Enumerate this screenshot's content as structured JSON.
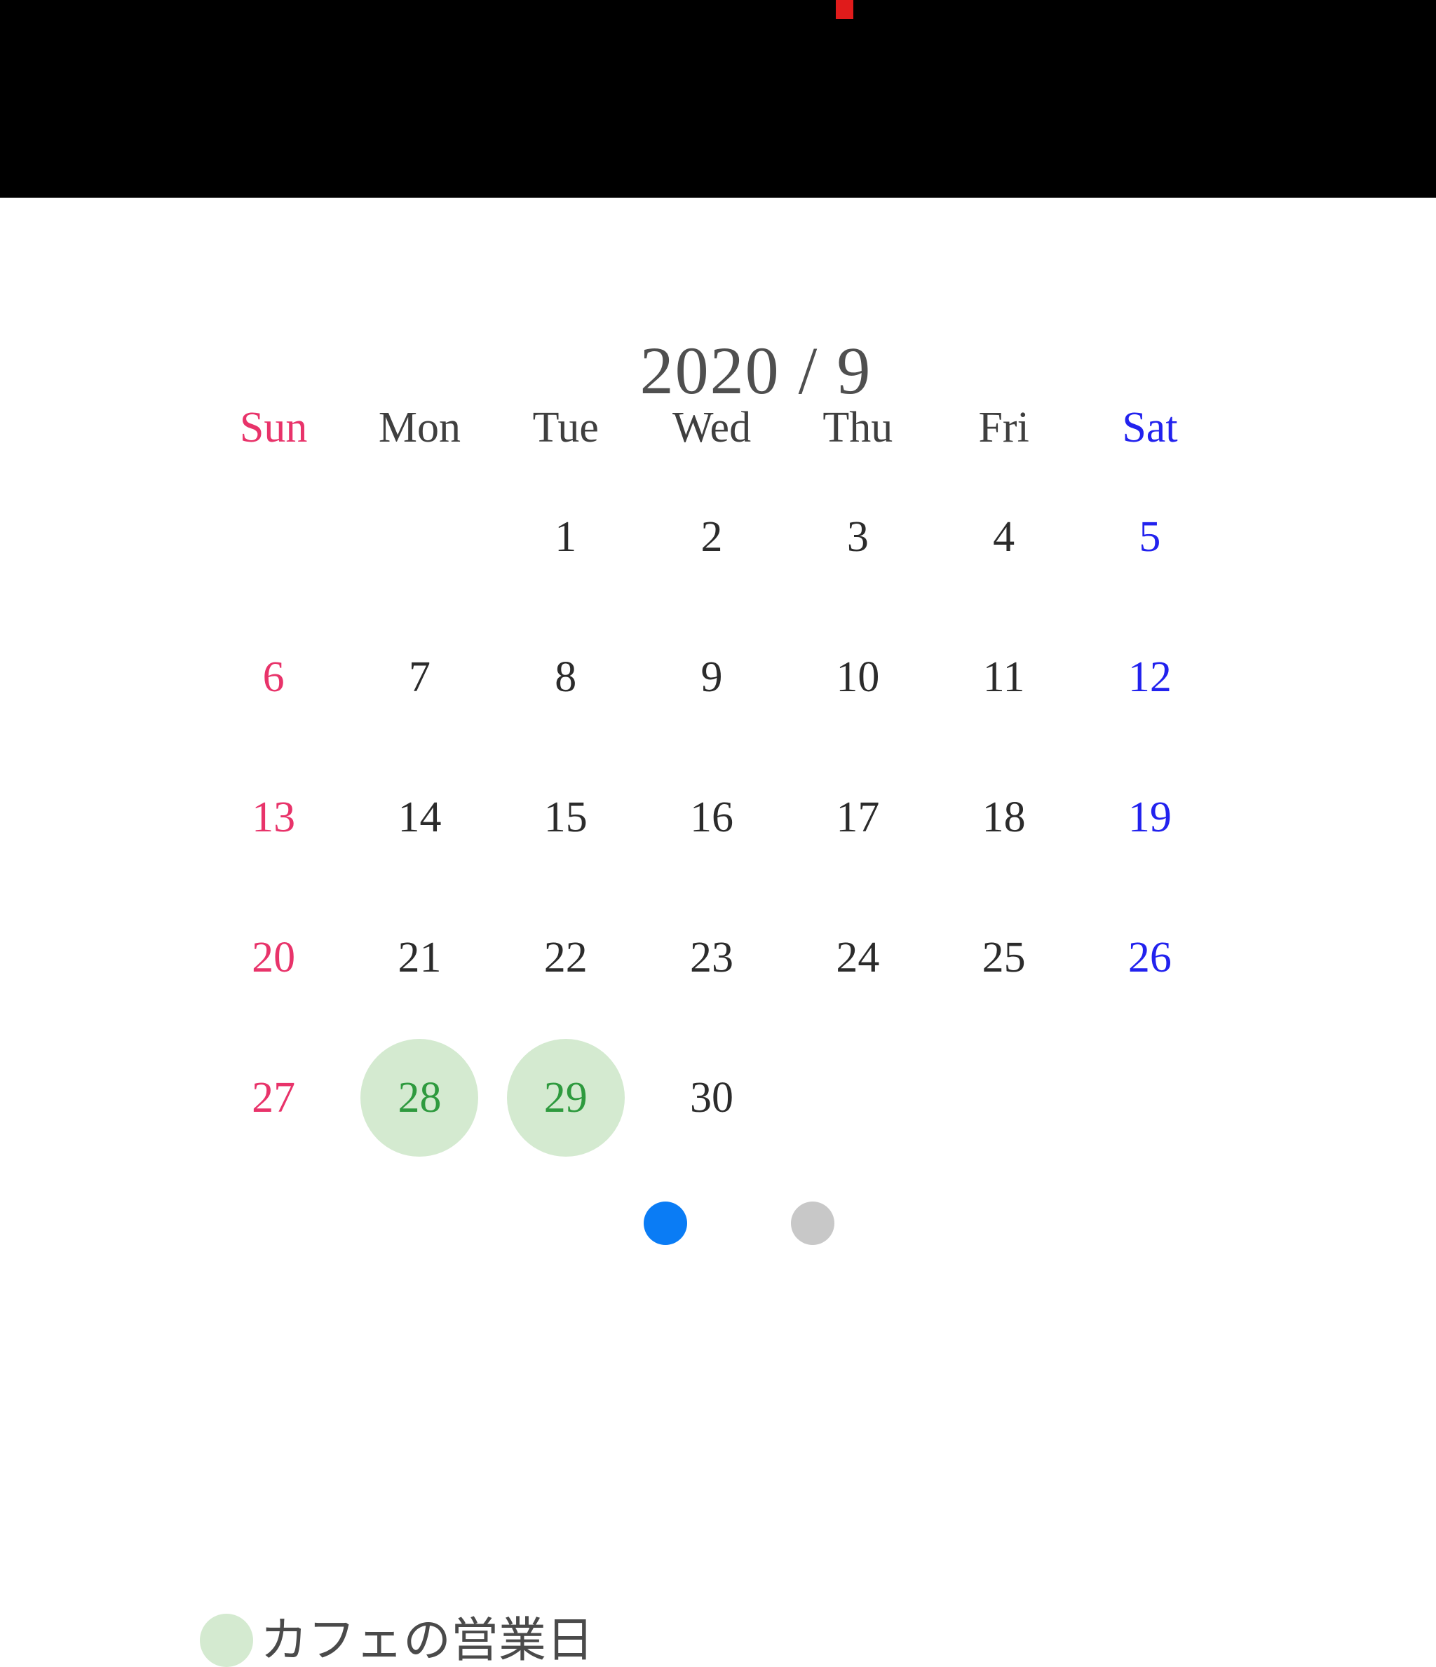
{
  "top_bar": {
    "marker_color": "#e01b1b",
    "background_color": "#000000"
  },
  "header": {
    "title": "2020 / 9",
    "year": "2020",
    "month": "9",
    "title_color": "#4f4f4f"
  },
  "colors": {
    "sunday": "#e8336a",
    "saturday": "#2222ee",
    "weekday": "#2b2b2b",
    "open_day_text": "#2e9a3e",
    "open_day_disc": "#d4ead0",
    "pager_active": "#0a7cf5",
    "pager_inactive": "#c8c8c8"
  },
  "calendar": {
    "weekdays": [
      {
        "label": "Sun",
        "kind": "sun"
      },
      {
        "label": "Mon",
        "kind": "weekday"
      },
      {
        "label": "Tue",
        "kind": "weekday"
      },
      {
        "label": "Wed",
        "kind": "weekday"
      },
      {
        "label": "Thu",
        "kind": "weekday"
      },
      {
        "label": "Fri",
        "kind": "weekday"
      },
      {
        "label": "Sat",
        "kind": "sat"
      }
    ],
    "weeks": [
      [
        {
          "day": "",
          "kind": "empty",
          "open": false
        },
        {
          "day": "",
          "kind": "empty",
          "open": false
        },
        {
          "day": "1",
          "kind": "weekday",
          "open": false
        },
        {
          "day": "2",
          "kind": "weekday",
          "open": false
        },
        {
          "day": "3",
          "kind": "weekday",
          "open": false
        },
        {
          "day": "4",
          "kind": "weekday",
          "open": false
        },
        {
          "day": "5",
          "kind": "sat",
          "open": false
        }
      ],
      [
        {
          "day": "6",
          "kind": "sun",
          "open": false
        },
        {
          "day": "7",
          "kind": "weekday",
          "open": false
        },
        {
          "day": "8",
          "kind": "weekday",
          "open": false
        },
        {
          "day": "9",
          "kind": "weekday",
          "open": false
        },
        {
          "day": "10",
          "kind": "weekday",
          "open": false
        },
        {
          "day": "11",
          "kind": "weekday",
          "open": false
        },
        {
          "day": "12",
          "kind": "sat",
          "open": false
        }
      ],
      [
        {
          "day": "13",
          "kind": "sun",
          "open": false
        },
        {
          "day": "14",
          "kind": "weekday",
          "open": false
        },
        {
          "day": "15",
          "kind": "weekday",
          "open": false
        },
        {
          "day": "16",
          "kind": "weekday",
          "open": false
        },
        {
          "day": "17",
          "kind": "weekday",
          "open": false
        },
        {
          "day": "18",
          "kind": "weekday",
          "open": false
        },
        {
          "day": "19",
          "kind": "sat",
          "open": false
        }
      ],
      [
        {
          "day": "20",
          "kind": "sun",
          "open": false
        },
        {
          "day": "21",
          "kind": "weekday",
          "open": false
        },
        {
          "day": "22",
          "kind": "weekday",
          "open": false
        },
        {
          "day": "23",
          "kind": "weekday",
          "open": false
        },
        {
          "day": "24",
          "kind": "weekday",
          "open": false
        },
        {
          "day": "25",
          "kind": "weekday",
          "open": false
        },
        {
          "day": "26",
          "kind": "sat",
          "open": false
        }
      ],
      [
        {
          "day": "27",
          "kind": "sun",
          "open": false
        },
        {
          "day": "28",
          "kind": "open",
          "open": true
        },
        {
          "day": "29",
          "kind": "open",
          "open": true
        },
        {
          "day": "30",
          "kind": "weekday",
          "open": false
        },
        {
          "day": "",
          "kind": "empty",
          "open": false
        },
        {
          "day": "",
          "kind": "empty",
          "open": false
        },
        {
          "day": "",
          "kind": "empty",
          "open": false
        }
      ]
    ]
  },
  "pager": {
    "dots": [
      {
        "active": true
      },
      {
        "active": false
      }
    ],
    "count": 2,
    "current": 1
  },
  "legend": {
    "label": "カフェの営業日",
    "swatch_color": "#d4ead0"
  }
}
